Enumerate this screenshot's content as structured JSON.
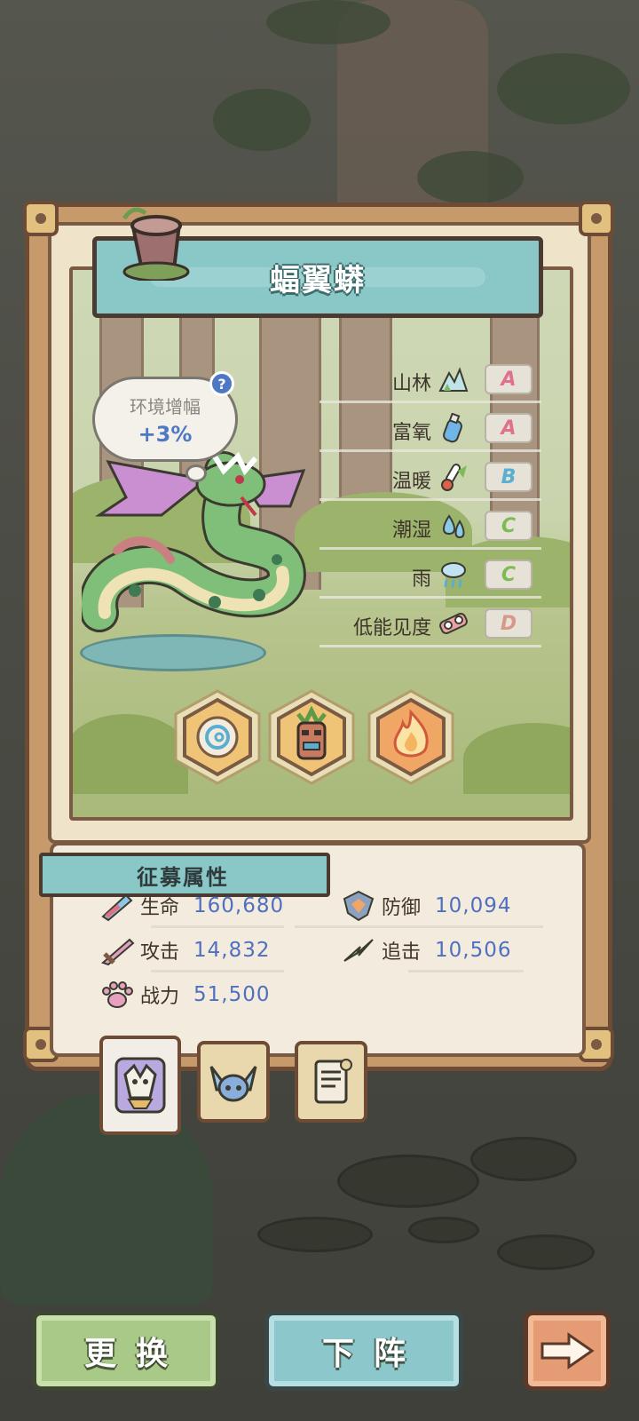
{
  "creature": {
    "name": "蝠翼蟒"
  },
  "environment_bonus": {
    "label": "环境增幅",
    "value": "+3%",
    "help_icon": "question-icon",
    "help_text": "?"
  },
  "environment": [
    {
      "name": "山林",
      "icon": "mountain-forest-icon",
      "grade": "A",
      "grade_color": "#e0708e"
    },
    {
      "name": "富氧",
      "icon": "oxygen-bottle-icon",
      "grade": "A",
      "grade_color": "#e0708e"
    },
    {
      "name": "温暖",
      "icon": "thermometer-icon",
      "grade": "B",
      "grade_color": "#5aaed0"
    },
    {
      "name": "潮湿",
      "icon": "water-drops-icon",
      "grade": "C",
      "grade_color": "#7fbb55"
    },
    {
      "name": "雨",
      "icon": "rain-cloud-icon",
      "grade": "C",
      "grade_color": "#7fbb55"
    },
    {
      "name": "低能见度",
      "icon": "goggles-icon",
      "grade": "D",
      "grade_color": "#d7988a"
    }
  ],
  "skills": [
    {
      "icon": "spiral-coin-icon"
    },
    {
      "icon": "tribal-mask-icon"
    },
    {
      "icon": "flame-icon"
    }
  ],
  "stats": {
    "title": "征募属性",
    "items": [
      {
        "label": "生命",
        "value": "160,680",
        "icon": "potion-icon"
      },
      {
        "label": "防御",
        "value": "10,094",
        "icon": "shield-icon"
      },
      {
        "label": "攻击",
        "value": "14,832",
        "icon": "sword-icon"
      },
      {
        "label": "追击",
        "value": "10,506",
        "icon": "lightning-icon"
      },
      {
        "label": "战力",
        "value": "51,500",
        "icon": "paw-icon"
      }
    ]
  },
  "tabs": [
    {
      "icon": "creature-portrait-icon",
      "active": true
    },
    {
      "icon": "horned-helmet-icon",
      "active": false
    },
    {
      "icon": "scroll-icon",
      "active": false
    }
  ],
  "buttons": {
    "swap": "更换",
    "withdraw": "下阵",
    "next_icon": "arrow-right-icon"
  },
  "colors": {
    "teal_banner": "#8ac8c8",
    "stat_value": "#4f6fc0",
    "button_green": "#a9c989",
    "button_teal": "#8cc7cc",
    "button_orange": "#e59b73"
  }
}
